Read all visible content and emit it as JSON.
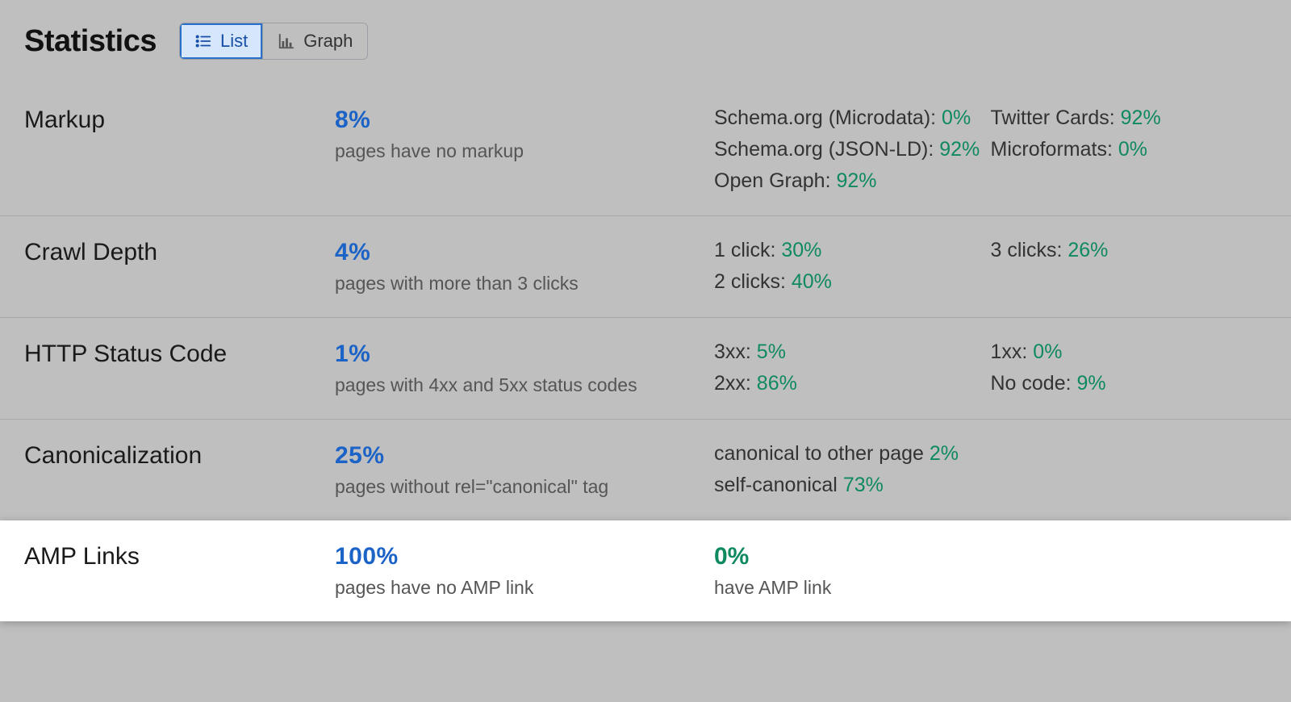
{
  "header": {
    "title": "Statistics",
    "seg": {
      "list": "List",
      "graph": "Graph",
      "active": "list"
    }
  },
  "rows": {
    "markup": {
      "name": "Markup",
      "pct": "8%",
      "desc": "pages have no markup",
      "col1": [
        {
          "label": "Schema.org (Microdata): ",
          "value": "0%"
        },
        {
          "label": "Schema.org (JSON-LD): ",
          "value": "92%"
        },
        {
          "label": "Open Graph: ",
          "value": "92%"
        }
      ],
      "col2": [
        {
          "label": "Twitter Cards: ",
          "value": "92%"
        },
        {
          "label": "Microformats: ",
          "value": "0%"
        }
      ]
    },
    "crawl": {
      "name": "Crawl Depth",
      "pct": "4%",
      "desc": "pages with more than 3 clicks",
      "col1": [
        {
          "label": "1 click: ",
          "value": "30%"
        },
        {
          "label": "2 clicks: ",
          "value": "40%"
        }
      ],
      "col2": [
        {
          "label": "3 clicks: ",
          "value": "26%"
        }
      ]
    },
    "http": {
      "name": "HTTP Status Code",
      "pct": "1%",
      "desc": "pages with 4xx and 5xx status codes",
      "col1": [
        {
          "label": "3xx: ",
          "value": "5%"
        },
        {
          "label": "2xx: ",
          "value": "86%"
        }
      ],
      "col2": [
        {
          "label": "1xx: ",
          "value": "0%"
        },
        {
          "label": "No code: ",
          "value": "9%"
        }
      ]
    },
    "canon": {
      "name": "Canonicalization",
      "pct": "25%",
      "desc": "pages without rel=\"canonical\" tag",
      "col1": [
        {
          "label": "canonical to other page ",
          "value": "2%"
        },
        {
          "label": "self-canonical ",
          "value": "73%"
        }
      ],
      "col2": []
    },
    "amp": {
      "name": "AMP Links",
      "pct": "100%",
      "desc": "pages have no AMP link",
      "have_pct": "0%",
      "have_desc": "have AMP link"
    }
  }
}
